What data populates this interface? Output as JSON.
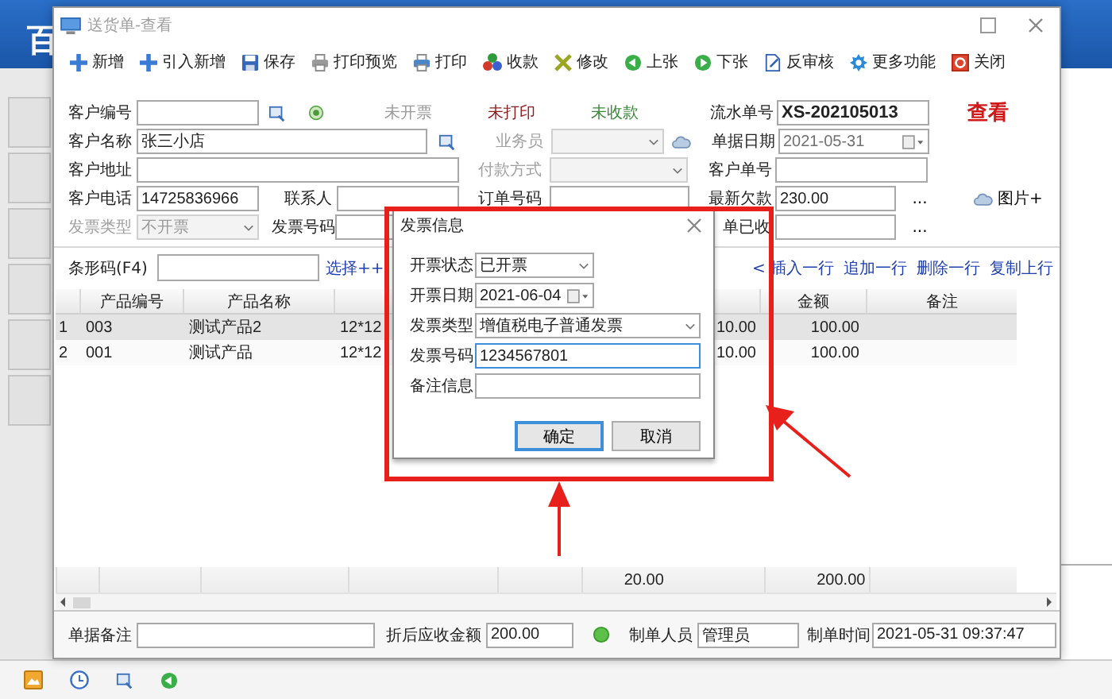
{
  "background_app": {
    "banner_text": "百"
  },
  "window": {
    "title": "送货单-查看"
  },
  "toolbar": [
    {
      "label": "新增"
    },
    {
      "label": "引入新增"
    },
    {
      "label": "保存"
    },
    {
      "label": "打印预览"
    },
    {
      "label": "打印"
    },
    {
      "label": "收款"
    },
    {
      "label": "修改"
    },
    {
      "label": "上张"
    },
    {
      "label": "下张"
    },
    {
      "label": "反审核"
    },
    {
      "label": "更多功能"
    },
    {
      "label": "关闭"
    }
  ],
  "customer": {
    "code": {
      "label": "客户编号"
    },
    "name": {
      "label": "客户名称",
      "value": "张三小店"
    },
    "address": {
      "label": "客户地址"
    },
    "phone": {
      "label": "客户电话",
      "value": "14725836966"
    },
    "contact": {
      "label": "联系人"
    },
    "invoice_type": {
      "label": "发票类型",
      "value": "不开票",
      "disabled": true
    },
    "invoice_number": {
      "label": "发票号码"
    }
  },
  "statuses": [
    {
      "text": "未开票",
      "color": "#9a9a9a"
    },
    {
      "text": "未打印",
      "color": "#8b1c1c"
    },
    {
      "text": "未收款",
      "color": "#3a8a3a"
    }
  ],
  "middle": {
    "salesperson": {
      "label": "业务员",
      "disabled": true
    },
    "payment_method": {
      "label": "付款方式",
      "disabled": true
    },
    "order_number": {
      "label": "订单号码"
    }
  },
  "document": {
    "serial": {
      "label": "流水单号",
      "value": "XS-202105013"
    },
    "date": {
      "label": "单据日期",
      "value": "2021-05-31",
      "readonly": true
    },
    "customer_ref": {
      "label": "客户单号"
    },
    "latest_debt": {
      "label": "最新欠款",
      "value": "230.00",
      "more_button": "..."
    },
    "received": {
      "label": "单已收",
      "more_button": "..."
    }
  },
  "mode_stamp": "查看",
  "picture_button": {
    "label": "图片+"
  },
  "barcode": {
    "label": "条形码(F4)",
    "select_link": "选择++"
  },
  "row_actions": [
    "< 插入一行",
    "追加一行",
    "删除一行",
    "复制上行"
  ],
  "table": {
    "columns": [
      {
        "kind": "index"
      },
      {
        "kind": "data",
        "label": "产品编号"
      },
      {
        "kind": "data",
        "label": "产品名称"
      },
      {
        "kind": "data"
      },
      {
        "kind": "data"
      },
      {
        "kind": "data"
      },
      {
        "kind": "data",
        "label": "金额"
      },
      {
        "kind": "data",
        "label": "备注"
      }
    ],
    "rows": [
      {
        "selected": true,
        "cells": [
          "1",
          "003",
          "测试产品2",
          "12*12",
          null,
          "10.00",
          "100.00",
          null
        ]
      },
      {
        "selected": false,
        "cells": [
          "2",
          "001",
          "测试产品",
          "12*12",
          null,
          "10.00",
          "100.00",
          null
        ]
      }
    ],
    "totals": {
      "column_6": "20.00",
      "amount": "200.00"
    }
  },
  "footer": {
    "remarks": {
      "label": "单据备注"
    },
    "net_receivable": {
      "label": "折后应收金额",
      "value": "200.00"
    },
    "creator": {
      "label": "制单人员",
      "value": "管理员"
    },
    "created_at": {
      "label": "制单时间",
      "value": "2021-05-31 09:37:47"
    }
  },
  "dialog": {
    "title": "发票信息",
    "fields": [
      {
        "kind": "combo",
        "label": "开票状态",
        "value": "已开票",
        "focused": false
      },
      {
        "kind": "date",
        "label": "开票日期",
        "value": "2021-06-04",
        "focused": false
      },
      {
        "kind": "combo",
        "label": "发票类型",
        "value": "增值税电子普通发票",
        "focused": false
      },
      {
        "kind": "text",
        "label": "发票号码",
        "value": "1234567801",
        "focused": true
      },
      {
        "kind": "text",
        "label": "备注信息",
        "focused": false
      }
    ],
    "buttons": [
      {
        "label": "确定",
        "default": true
      },
      {
        "label": "取消",
        "default": false
      }
    ]
  }
}
